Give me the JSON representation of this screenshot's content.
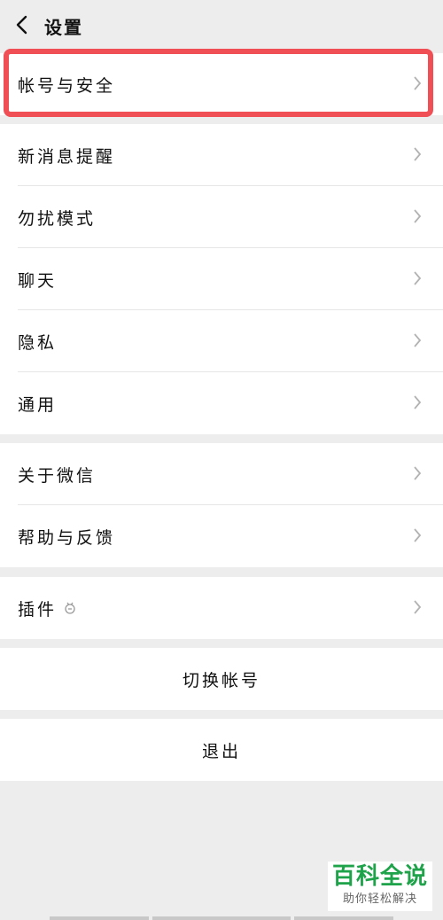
{
  "header": {
    "title": "设置"
  },
  "groups": {
    "account": [
      {
        "label": "帐号与安全"
      }
    ],
    "main": [
      {
        "label": "新消息提醒"
      },
      {
        "label": "勿扰模式"
      },
      {
        "label": "聊天"
      },
      {
        "label": "隐私"
      },
      {
        "label": "通用"
      }
    ],
    "about": [
      {
        "label": "关于微信"
      },
      {
        "label": "帮助与反馈"
      }
    ],
    "plugins": [
      {
        "label": "插件"
      }
    ]
  },
  "actions": {
    "switch_account": "切换帐号",
    "logout": "退出"
  },
  "watermark": {
    "title": "百科全说",
    "subtitle": "助你轻松解决"
  },
  "colors": {
    "highlight": "#ef4f55",
    "watermark_green": "#1fa34a"
  },
  "icons": [
    "back-arrow-icon",
    "chevron-right-icon",
    "plugin-bug-icon"
  ]
}
